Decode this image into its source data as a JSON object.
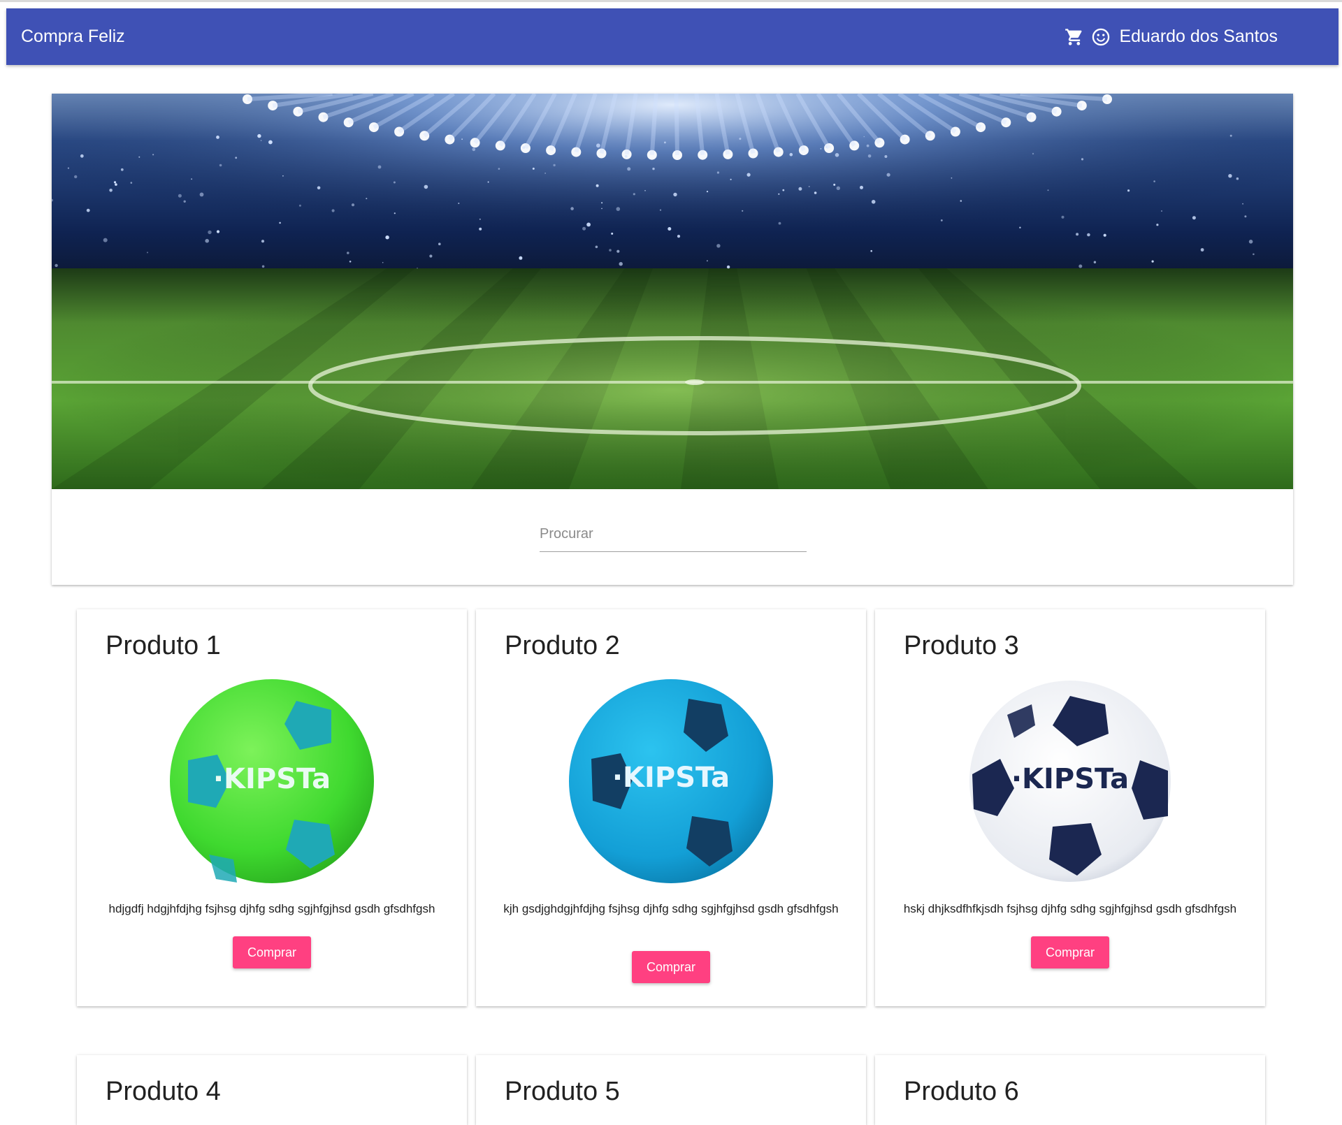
{
  "appbar": {
    "brand": "Compra Feliz",
    "user_name": "Eduardo dos Santos",
    "color": "#3f51b5"
  },
  "search": {
    "placeholder": "Procurar"
  },
  "products": [
    {
      "title": "Produto 1",
      "description": "hdjgdfj hdgjhfdjhg fsjhsg djhfg sdhg sgjhfgjhsd gsdh gfsdhfgsh",
      "button": "Comprar",
      "ball": "green"
    },
    {
      "title": "Produto 2",
      "description": "kjh gsdjghdgjhfdjhg fsjhsg djhfg sdhg sgjhfgjhsd gsdh gfsdhfgsh",
      "button": "Comprar",
      "ball": "blue"
    },
    {
      "title": "Produto 3",
      "description": "hskj dhjksdfhfkjsdh fsjhsg djhfg sdhg sgjhfgjhsd gsdh gfsdhfgsh",
      "button": "Comprar",
      "ball": "white"
    },
    {
      "title": "Produto 4"
    },
    {
      "title": "Produto 5"
    },
    {
      "title": "Produto 6"
    }
  ],
  "ball_logo": "·KIPSTa",
  "accent_color": "#ff4081"
}
